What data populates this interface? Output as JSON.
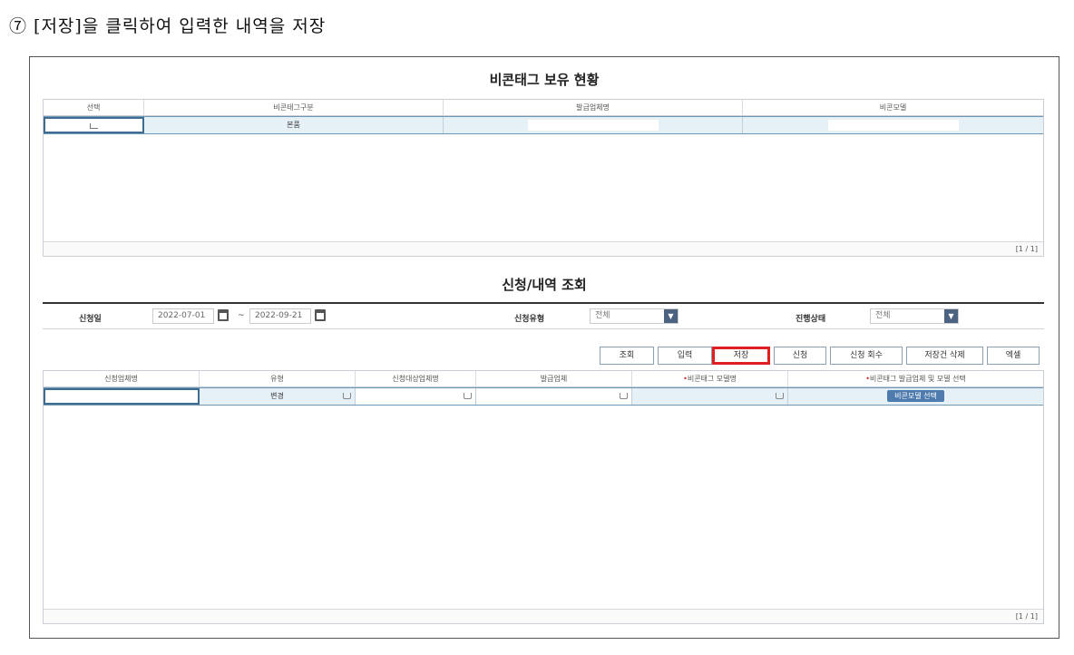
{
  "caption": "⑦ [저장]을 클릭하여 입력한 내역을 저장",
  "holdings": {
    "title": "비콘태그 보유 현황",
    "columns": [
      "선택",
      "비콘태그구분",
      "발급업체명",
      "비콘모델"
    ],
    "row": {
      "type": "본품"
    },
    "pager": "[1 / 1]"
  },
  "search_section": {
    "title": "신청/내역 조회",
    "date_label": "신청일",
    "date_from": "2022-07-01",
    "date_sep": "~",
    "date_to": "2022-09-21",
    "type_label": "신청유형",
    "type_value": "전체",
    "status_label": "진행상태",
    "status_value": "전체"
  },
  "actions": [
    "조회",
    "입력",
    "저장",
    "신청",
    "신청 회수",
    "저장건 삭제",
    "엑셀"
  ],
  "highlight_action": "저장",
  "application": {
    "columns": [
      "신청업체명",
      "유형",
      "신청대상업체명",
      "발급업체",
      "비콘태그 모델명",
      "비콘태그 발급업체 및 모델 선택"
    ],
    "required_mark": "•",
    "row": {
      "type": "변경",
      "select_button": "비콘모델 선택"
    },
    "pager": "[1 / 1]"
  },
  "colors": {
    "row_bg": "#e6f0f7",
    "header_rule": "#333333",
    "highlight": "#e02020",
    "select_arrow": "#4b6280",
    "beacon_button": "#4f7cae"
  }
}
